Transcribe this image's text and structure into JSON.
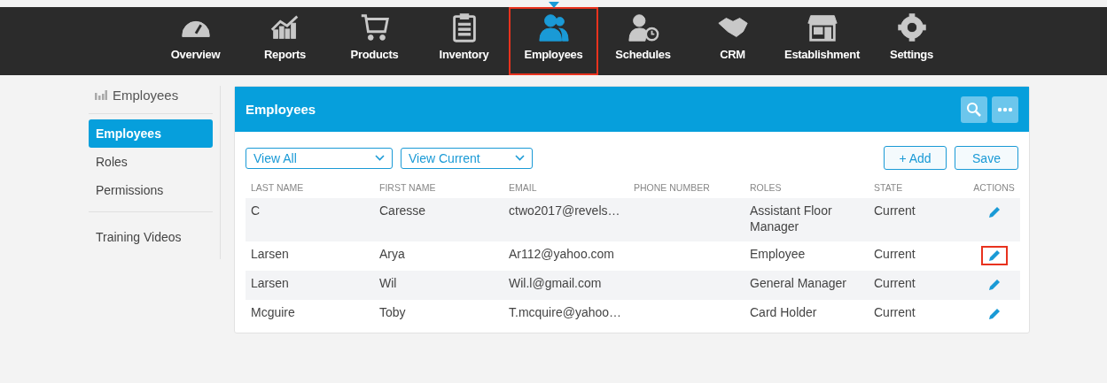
{
  "nav": [
    {
      "label": "Overview",
      "selected": false,
      "highlighted": false
    },
    {
      "label": "Reports",
      "selected": false,
      "highlighted": false
    },
    {
      "label": "Products",
      "selected": false,
      "highlighted": false
    },
    {
      "label": "Inventory",
      "selected": false,
      "highlighted": false
    },
    {
      "label": "Employees",
      "selected": true,
      "highlighted": true
    },
    {
      "label": "Schedules",
      "selected": false,
      "highlighted": false
    },
    {
      "label": "CRM",
      "selected": false,
      "highlighted": false
    },
    {
      "label": "Establishment",
      "selected": false,
      "highlighted": false
    },
    {
      "label": "Settings",
      "selected": false,
      "highlighted": false
    }
  ],
  "sidebar": {
    "title": "Employees",
    "groups": [
      [
        {
          "label": "Employees",
          "selected": true
        },
        {
          "label": "Roles",
          "selected": false
        },
        {
          "label": "Permissions",
          "selected": false
        }
      ],
      [
        {
          "label": "Training Videos",
          "selected": false
        }
      ]
    ]
  },
  "panel": {
    "title": "Employees",
    "filters": [
      "View All",
      "View Current"
    ],
    "buttons": [
      "+ Add",
      "Save"
    ],
    "table": {
      "columns": [
        "LAST NAME",
        "FIRST NAME",
        "EMAIL",
        "PHONE NUMBER",
        "ROLES",
        "STATE",
        "ACTIONS"
      ],
      "rows": [
        {
          "cells": [
            "C",
            "Caresse",
            "ctwo2017@revels…",
            "",
            "Assistant Floor Manager",
            "Current"
          ],
          "highlighted": false
        },
        {
          "cells": [
            "Larsen",
            "Arya",
            "Ar112@yahoo.com",
            "",
            "Employee",
            "Current"
          ],
          "highlighted": true
        },
        {
          "cells": [
            "Larsen",
            "Wil",
            "Wil.l@gmail.com",
            "",
            "General Manager",
            "Current"
          ],
          "highlighted": false
        },
        {
          "cells": [
            "Mcguire",
            "Toby",
            "T.mcquire@yahoo…",
            "",
            "Card Holder",
            "Current"
          ],
          "highlighted": false
        }
      ]
    }
  }
}
